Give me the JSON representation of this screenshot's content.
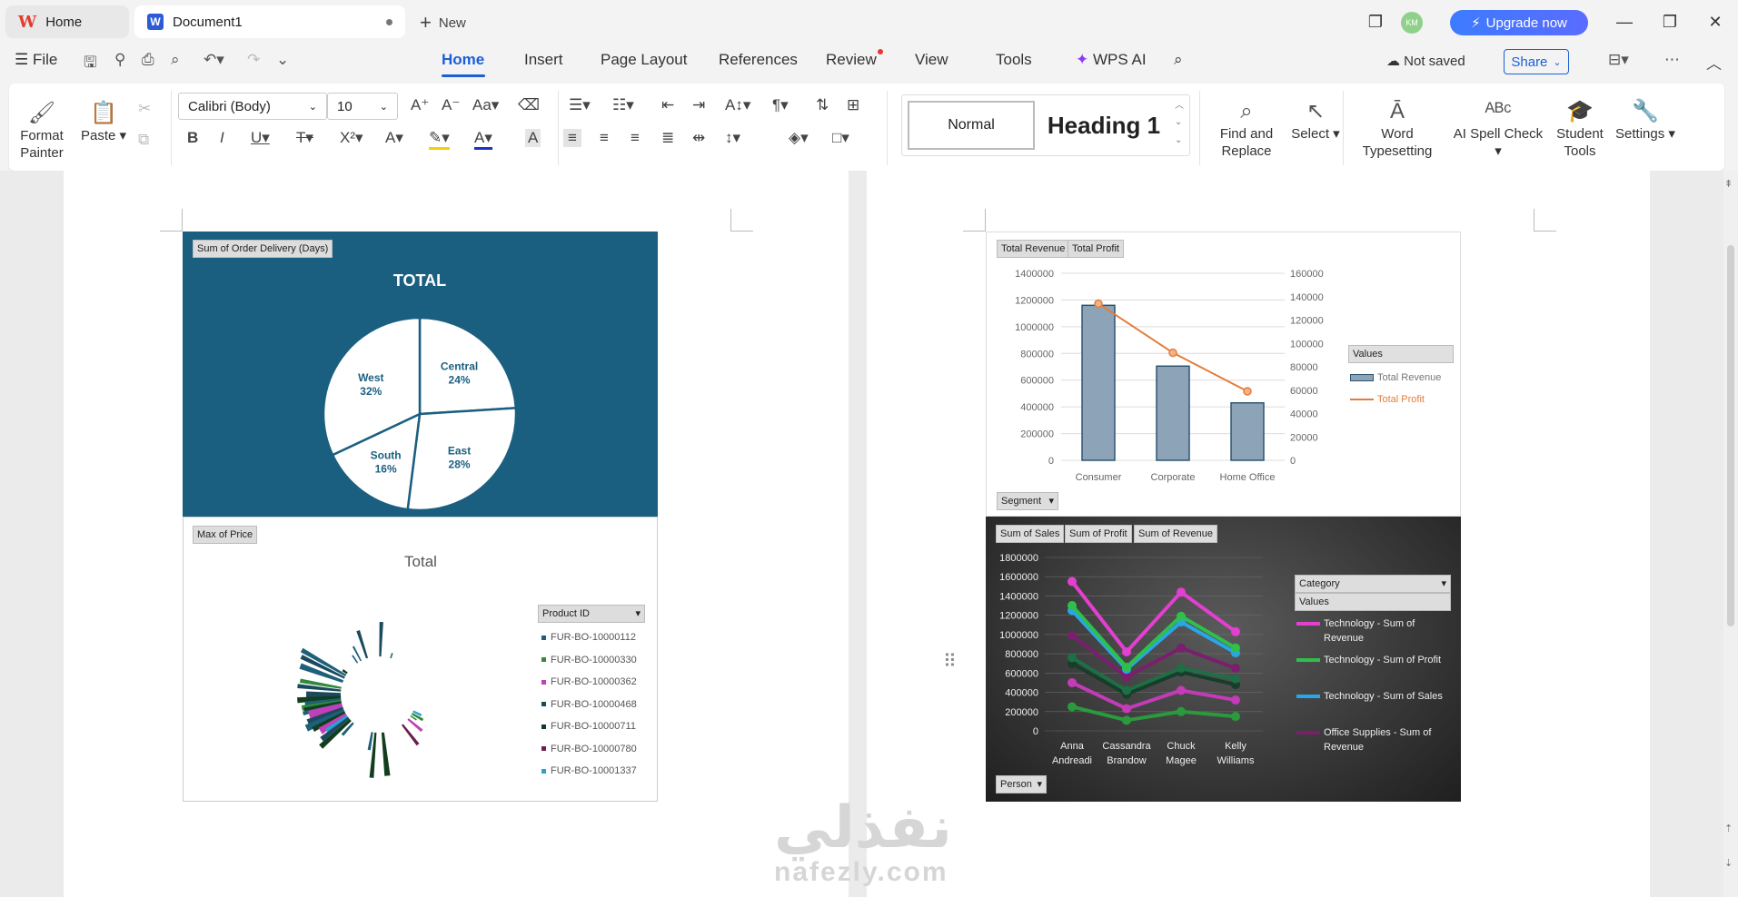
{
  "titlebar": {
    "home_tab": "Home",
    "doc_tab": "Document1",
    "new_tab": "New",
    "upgrade": "Upgrade now",
    "avatar": "KM"
  },
  "menubar": {
    "file": "File",
    "tabs": [
      "Home",
      "Insert",
      "Page Layout",
      "References",
      "Review",
      "View",
      "Tools"
    ],
    "wps_ai": "WPS AI",
    "status": "Not saved",
    "share": "Share"
  },
  "ribbon": {
    "format_painter": "Format Painter",
    "paste": "Paste",
    "font_name": "Calibri (Body)",
    "font_size": "10",
    "style_normal": "Normal",
    "style_heading": "Heading 1",
    "find_replace": "Find and Replace",
    "select": "Select",
    "word_typesetting": "Word Typesetting",
    "ai_spell": "AI Spell Check",
    "student_tools": "Student Tools",
    "settings": "Settings"
  },
  "watermark": {
    "line1": "نفذلي",
    "line2": "nafezly.com"
  },
  "chart_data": [
    {
      "type": "pie",
      "field_button": "Sum of Order Delivery (Days)",
      "title": "TOTAL",
      "categories": [
        "Central",
        "East",
        "South",
        "West"
      ],
      "values": [
        24,
        28,
        16,
        32
      ],
      "labels": [
        "24%",
        "28%",
        "16%",
        "32%"
      ],
      "colors": {
        "background": "#1b5f80",
        "slice": "#ffffff",
        "text": "#1b5f80"
      }
    },
    {
      "type": "pie",
      "field_button": "Max of Price",
      "title": "Total",
      "legend_header": "Product ID",
      "legend": [
        "FUR-BO-10000112",
        "FUR-BO-10000330",
        "FUR-BO-10000362",
        "FUR-BO-10000468",
        "FUR-BO-10000711",
        "FUR-BO-10000780",
        "FUR-BO-10001337"
      ],
      "colors": [
        "#1e5f7a",
        "#2f8a3c",
        "#c13fb8",
        "#1b4a5e",
        "#123d1e",
        "#6b1f4e",
        "#2aa0d0"
      ],
      "legend_placement": "right"
    },
    {
      "type": "bar",
      "field_buttons": [
        "Total Revenue",
        "Total Profit"
      ],
      "row_button": "Segment",
      "categories": [
        "Consumer",
        "Corporate",
        "Home Office"
      ],
      "series": [
        {
          "name": "Total Revenue",
          "values": [
            1160000,
            705000,
            430000
          ],
          "type": "bar",
          "axis": "left"
        },
        {
          "name": "Total Profit",
          "values": [
            134000,
            92000,
            59000
          ],
          "type": "line",
          "axis": "right"
        }
      ],
      "ylim_left": [
        0,
        1400000
      ],
      "yticks_left": [
        "0",
        "200000",
        "400000",
        "600000",
        "800000",
        "1000000",
        "1200000",
        "1400000"
      ],
      "ylim_right": [
        0,
        160000
      ],
      "yticks_right": [
        "0",
        "20000",
        "40000",
        "60000",
        "80000",
        "100000",
        "120000",
        "140000",
        "160000"
      ],
      "legend_header": "Values",
      "legend_placement": "right",
      "colors": {
        "bar": "#8da4b8",
        "line": "#e57c3a"
      }
    },
    {
      "type": "line",
      "field_buttons": [
        "Sum of Sales",
        "Sum of Profit",
        "Sum of Revenue"
      ],
      "row_button": "Person",
      "category_button": "Category",
      "legend_header": "Values",
      "categories": [
        "Anna Andreadi",
        "Cassandra Brandow",
        "Chuck Magee",
        "Kelly Williams"
      ],
      "series": [
        {
          "name": "Technology - Sum of Revenue",
          "values": [
            1550000,
            820000,
            1440000,
            1030000
          ],
          "color": "#e33fd0"
        },
        {
          "name": "Technology - Sum of Profit",
          "values": [
            1300000,
            660000,
            1190000,
            860000
          ],
          "color": "#2fc04c"
        },
        {
          "name": "Technology - Sum of Sales",
          "values": [
            1250000,
            640000,
            1130000,
            810000
          ],
          "color": "#29a6e8"
        },
        {
          "name": "Office Supplies - Sum of Revenue",
          "values": [
            990000,
            560000,
            860000,
            650000
          ],
          "color": "#7a1f6e"
        },
        {
          "name": "",
          "values": [
            760000,
            420000,
            650000,
            540000
          ],
          "color": "#1e6e46"
        },
        {
          "name": "",
          "values": [
            700000,
            380000,
            610000,
            480000
          ],
          "color": "#163e2a"
        },
        {
          "name": "",
          "values": [
            500000,
            230000,
            420000,
            320000
          ],
          "color": "#c43bb8"
        },
        {
          "name": "",
          "values": [
            250000,
            110000,
            200000,
            150000
          ],
          "color": "#2a9a3c"
        }
      ],
      "ylim": [
        0,
        1800000
      ],
      "yticks": [
        "0",
        "200000",
        "400000",
        "600000",
        "800000",
        "1000000",
        "1200000",
        "1400000",
        "1600000",
        "1800000"
      ],
      "xtick_labels": [
        [
          "Anna",
          "Andreadi"
        ],
        [
          "Cassandra",
          "Brandow"
        ],
        [
          "Chuck",
          "Magee"
        ],
        [
          "Kelly",
          "Williams"
        ]
      ],
      "legend_placement": "right"
    }
  ]
}
